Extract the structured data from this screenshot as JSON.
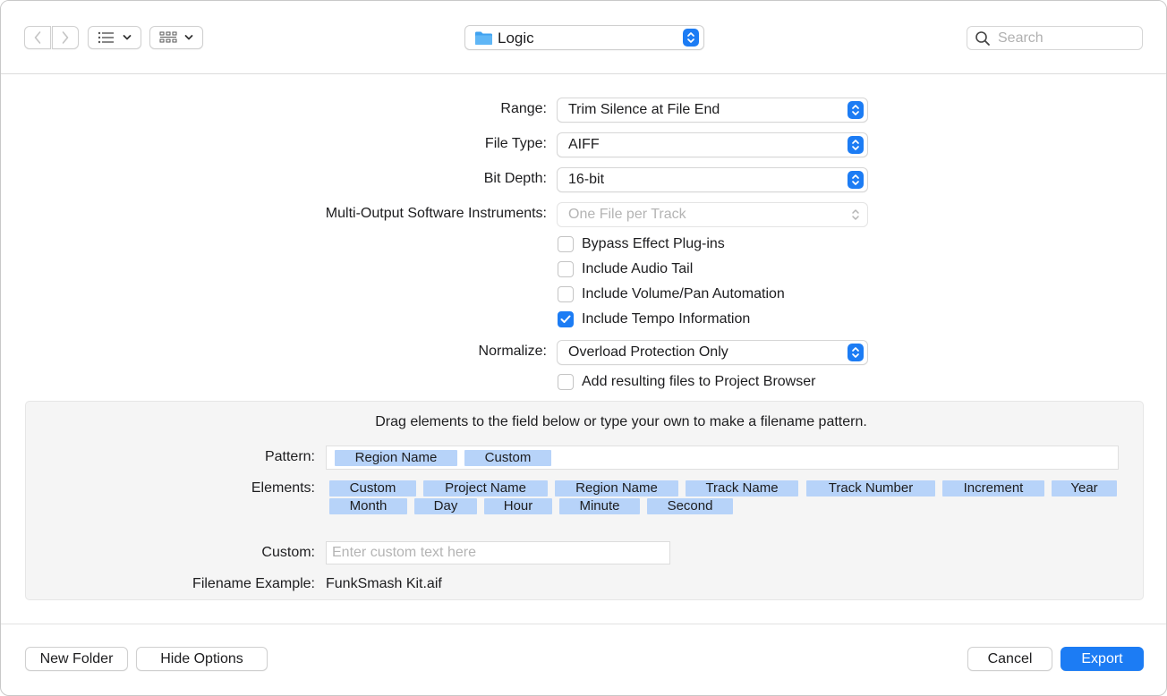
{
  "toolbar": {
    "location": "Logic",
    "search_placeholder": "Search"
  },
  "form": {
    "range": {
      "label": "Range:",
      "value": "Trim Silence at File End"
    },
    "file_type": {
      "label": "File Type:",
      "value": "AIFF"
    },
    "bit_depth": {
      "label": "Bit Depth:",
      "value": "16-bit"
    },
    "multi_output": {
      "label": "Multi-Output Software Instruments:",
      "value": "One File per Track"
    },
    "checks": [
      {
        "label": "Bypass Effect Plug-ins",
        "checked": false
      },
      {
        "label": "Include Audio Tail",
        "checked": false
      },
      {
        "label": "Include Volume/Pan Automation",
        "checked": false
      },
      {
        "label": "Include Tempo Information",
        "checked": true
      }
    ],
    "normalize": {
      "label": "Normalize:",
      "value": "Overload Protection Only"
    },
    "add_to_browser": {
      "label": "Add resulting files to Project Browser",
      "checked": false
    }
  },
  "filename": {
    "hint": "Drag elements to the field below or type your own to make a filename pattern.",
    "pattern_label": "Pattern:",
    "pattern_tokens": [
      "Region Name",
      "Custom"
    ],
    "elements_label": "Elements:",
    "elements": [
      "Custom",
      "Project Name",
      "Region Name",
      "Track Name",
      "Track Number",
      "Increment",
      "Year",
      "Month",
      "Day",
      "Hour",
      "Minute",
      "Second"
    ],
    "custom_label": "Custom:",
    "custom_placeholder": "Enter custom text here",
    "example_label": "Filename Example:",
    "example_value": "FunkSmash Kit.aif"
  },
  "buttons": {
    "new_folder": "New Folder",
    "hide_options": "Hide Options",
    "cancel": "Cancel",
    "export": "Export"
  },
  "colors": {
    "accent": "#1c7cf4",
    "token": "#b7d3f9",
    "panel": "#f5f5f5"
  }
}
